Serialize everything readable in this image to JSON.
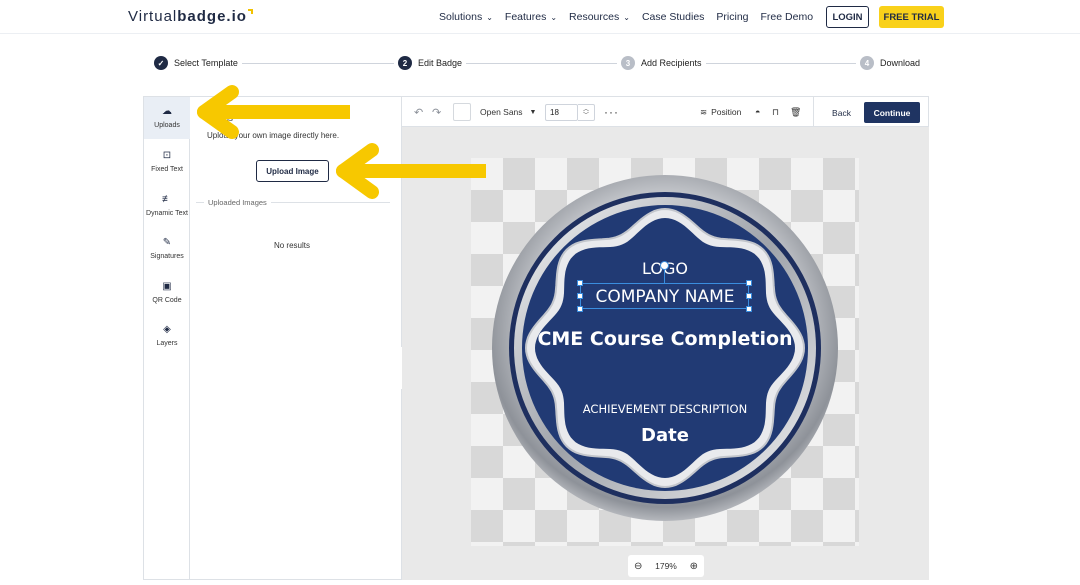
{
  "brand": {
    "name_light": "Virtual",
    "name_bold": "badge.io"
  },
  "nav": {
    "links": [
      {
        "label": "Solutions",
        "has_caret": true
      },
      {
        "label": "Features",
        "has_caret": true
      },
      {
        "label": "Resources",
        "has_caret": true
      },
      {
        "label": "Case Studies",
        "has_caret": false
      },
      {
        "label": "Pricing",
        "has_caret": false
      },
      {
        "label": "Free Demo",
        "has_caret": false
      }
    ],
    "login": "LOGIN",
    "free_trial": "FREE TRIAL"
  },
  "steps": [
    {
      "num": "✓",
      "label": "Select Template",
      "state": "done"
    },
    {
      "num": "2",
      "label": "Edit Badge",
      "state": "active"
    },
    {
      "num": "3",
      "label": "Add Recipients",
      "state": "todo"
    },
    {
      "num": "4",
      "label": "Download",
      "state": "todo"
    }
  ],
  "rail": [
    {
      "label": "Uploads",
      "icon": "upload-icon",
      "active": true
    },
    {
      "label": "Fixed Text",
      "icon": "fixed-text-icon",
      "active": false
    },
    {
      "label": "Dynamic Text",
      "icon": "dynamic-text-icon",
      "active": false
    },
    {
      "label": "Signatures",
      "icon": "signature-icon",
      "active": false
    },
    {
      "label": "QR Code",
      "icon": "qr-code-icon",
      "active": false
    },
    {
      "label": "Layers",
      "icon": "layers-icon",
      "active": false
    }
  ],
  "panel": {
    "title": "ads",
    "description": "Upload your own image directly here.",
    "upload_button": "Upload Image",
    "uploaded_label": "Uploaded Images",
    "empty": "No results"
  },
  "toolbar": {
    "font": "Open Sans",
    "font_size": "18",
    "position": "Position",
    "back": "Back",
    "continue": "Continue"
  },
  "badge": {
    "logo": "LOGO",
    "company": "COMPANY NAME",
    "title": "CME Course Completion",
    "description": "ACHIEVEMENT DESCRIPTION",
    "date": "Date",
    "colors": {
      "fill": "#213a74",
      "ring": "#c9ccd1",
      "accent": "#3a8dde"
    }
  },
  "zoom": {
    "level": "179%"
  },
  "colors": {
    "brand_dark": "#1f2a44",
    "trial_yellow": "#f9d11a",
    "continue_bg": "#1f3462",
    "arrow": "#f7c800"
  }
}
